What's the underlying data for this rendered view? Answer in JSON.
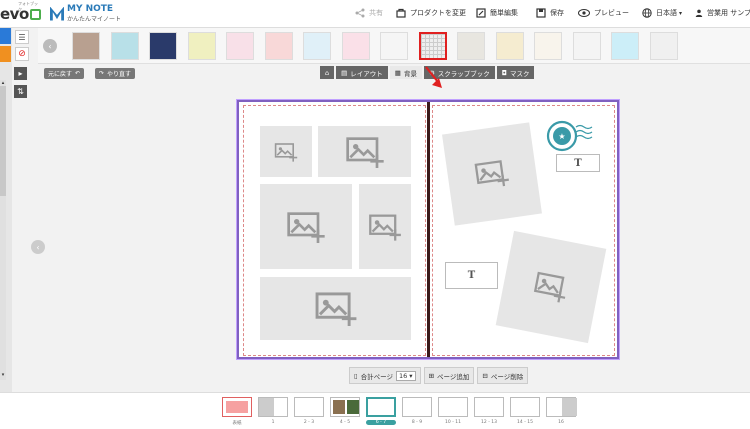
{
  "brand": {
    "logo1": "evo",
    "logo1_small": "フォトブック",
    "logo2_title": "MY NOTE",
    "logo2_sub": "かんたんマイノート"
  },
  "toolbar": {
    "share": "共有",
    "change_product": "プロダクトを変更",
    "simple_edit": "簡単編集",
    "save": "保存",
    "preview": "プレビュー",
    "language": "日本語",
    "user": "営業用 サンプ"
  },
  "history": {
    "undo": "元に戻す",
    "redo": "やり直す"
  },
  "tabs": [
    {
      "label": "レイアウト"
    },
    {
      "label": "背景"
    },
    {
      "label": "スクラップブック"
    },
    {
      "label": "マスク"
    }
  ],
  "swatches": [
    "#b8a090",
    "#b8e0e8",
    "#2a3a6a",
    "#f0f0c0",
    "#f8e0e8",
    "#f8d8d8",
    "#e0f0f8",
    "#fae0e8",
    "#f5f5f5",
    "#eeeeee",
    "#e8e6e0",
    "#f5ecd0",
    "#f8f4ec",
    "#f4f4f4",
    "#cceef8",
    "#f0f0f0"
  ],
  "selected_swatch_index": 9,
  "text_placeholder": "T",
  "pages_bar": {
    "total_label": "合計ページ",
    "total_value": "16",
    "add_label": "ページ追加",
    "delete_label": "ページ削除"
  },
  "thumbnails": [
    {
      "label": "表紙"
    },
    {
      "label": "1"
    },
    {
      "label": "2 - 3"
    },
    {
      "label": "4 - 5"
    },
    {
      "label": "6 - 7"
    },
    {
      "label": "8 - 9"
    },
    {
      "label": "10 - 11"
    },
    {
      "label": "12 - 13"
    },
    {
      "label": "14 - 15"
    },
    {
      "label": "16"
    }
  ],
  "colors": {
    "accent": "#e02020",
    "spread_border": "#8060c0",
    "spine": "#3b1a1a",
    "selected_thumb": "#3aa0a0"
  }
}
